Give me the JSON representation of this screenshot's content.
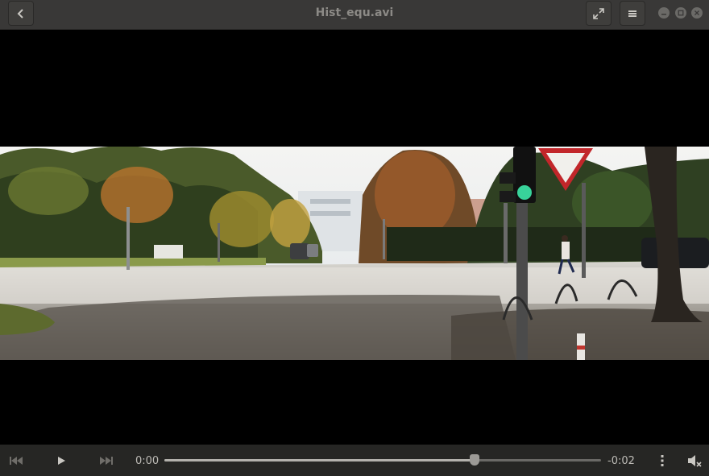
{
  "window": {
    "title": "Hist_equ.avi"
  },
  "icons": {
    "back": "back-arrow-icon",
    "fullscreen": "fullscreen-icon",
    "menu": "hamburger-menu-icon",
    "minimize": "minimize-icon",
    "maximize": "maximize-icon",
    "close": "close-icon",
    "previous": "skip-backward-icon",
    "play": "play-icon",
    "next": "skip-forward-icon",
    "more": "vertical-dots-icon",
    "volume": "volume-muted-icon"
  },
  "player": {
    "elapsed": "0:00",
    "remaining": "-0:02",
    "progress_fraction": 0.71
  },
  "colors": {
    "headerbar": "#393837",
    "controls": "#262624",
    "video_bg": "#000000"
  }
}
